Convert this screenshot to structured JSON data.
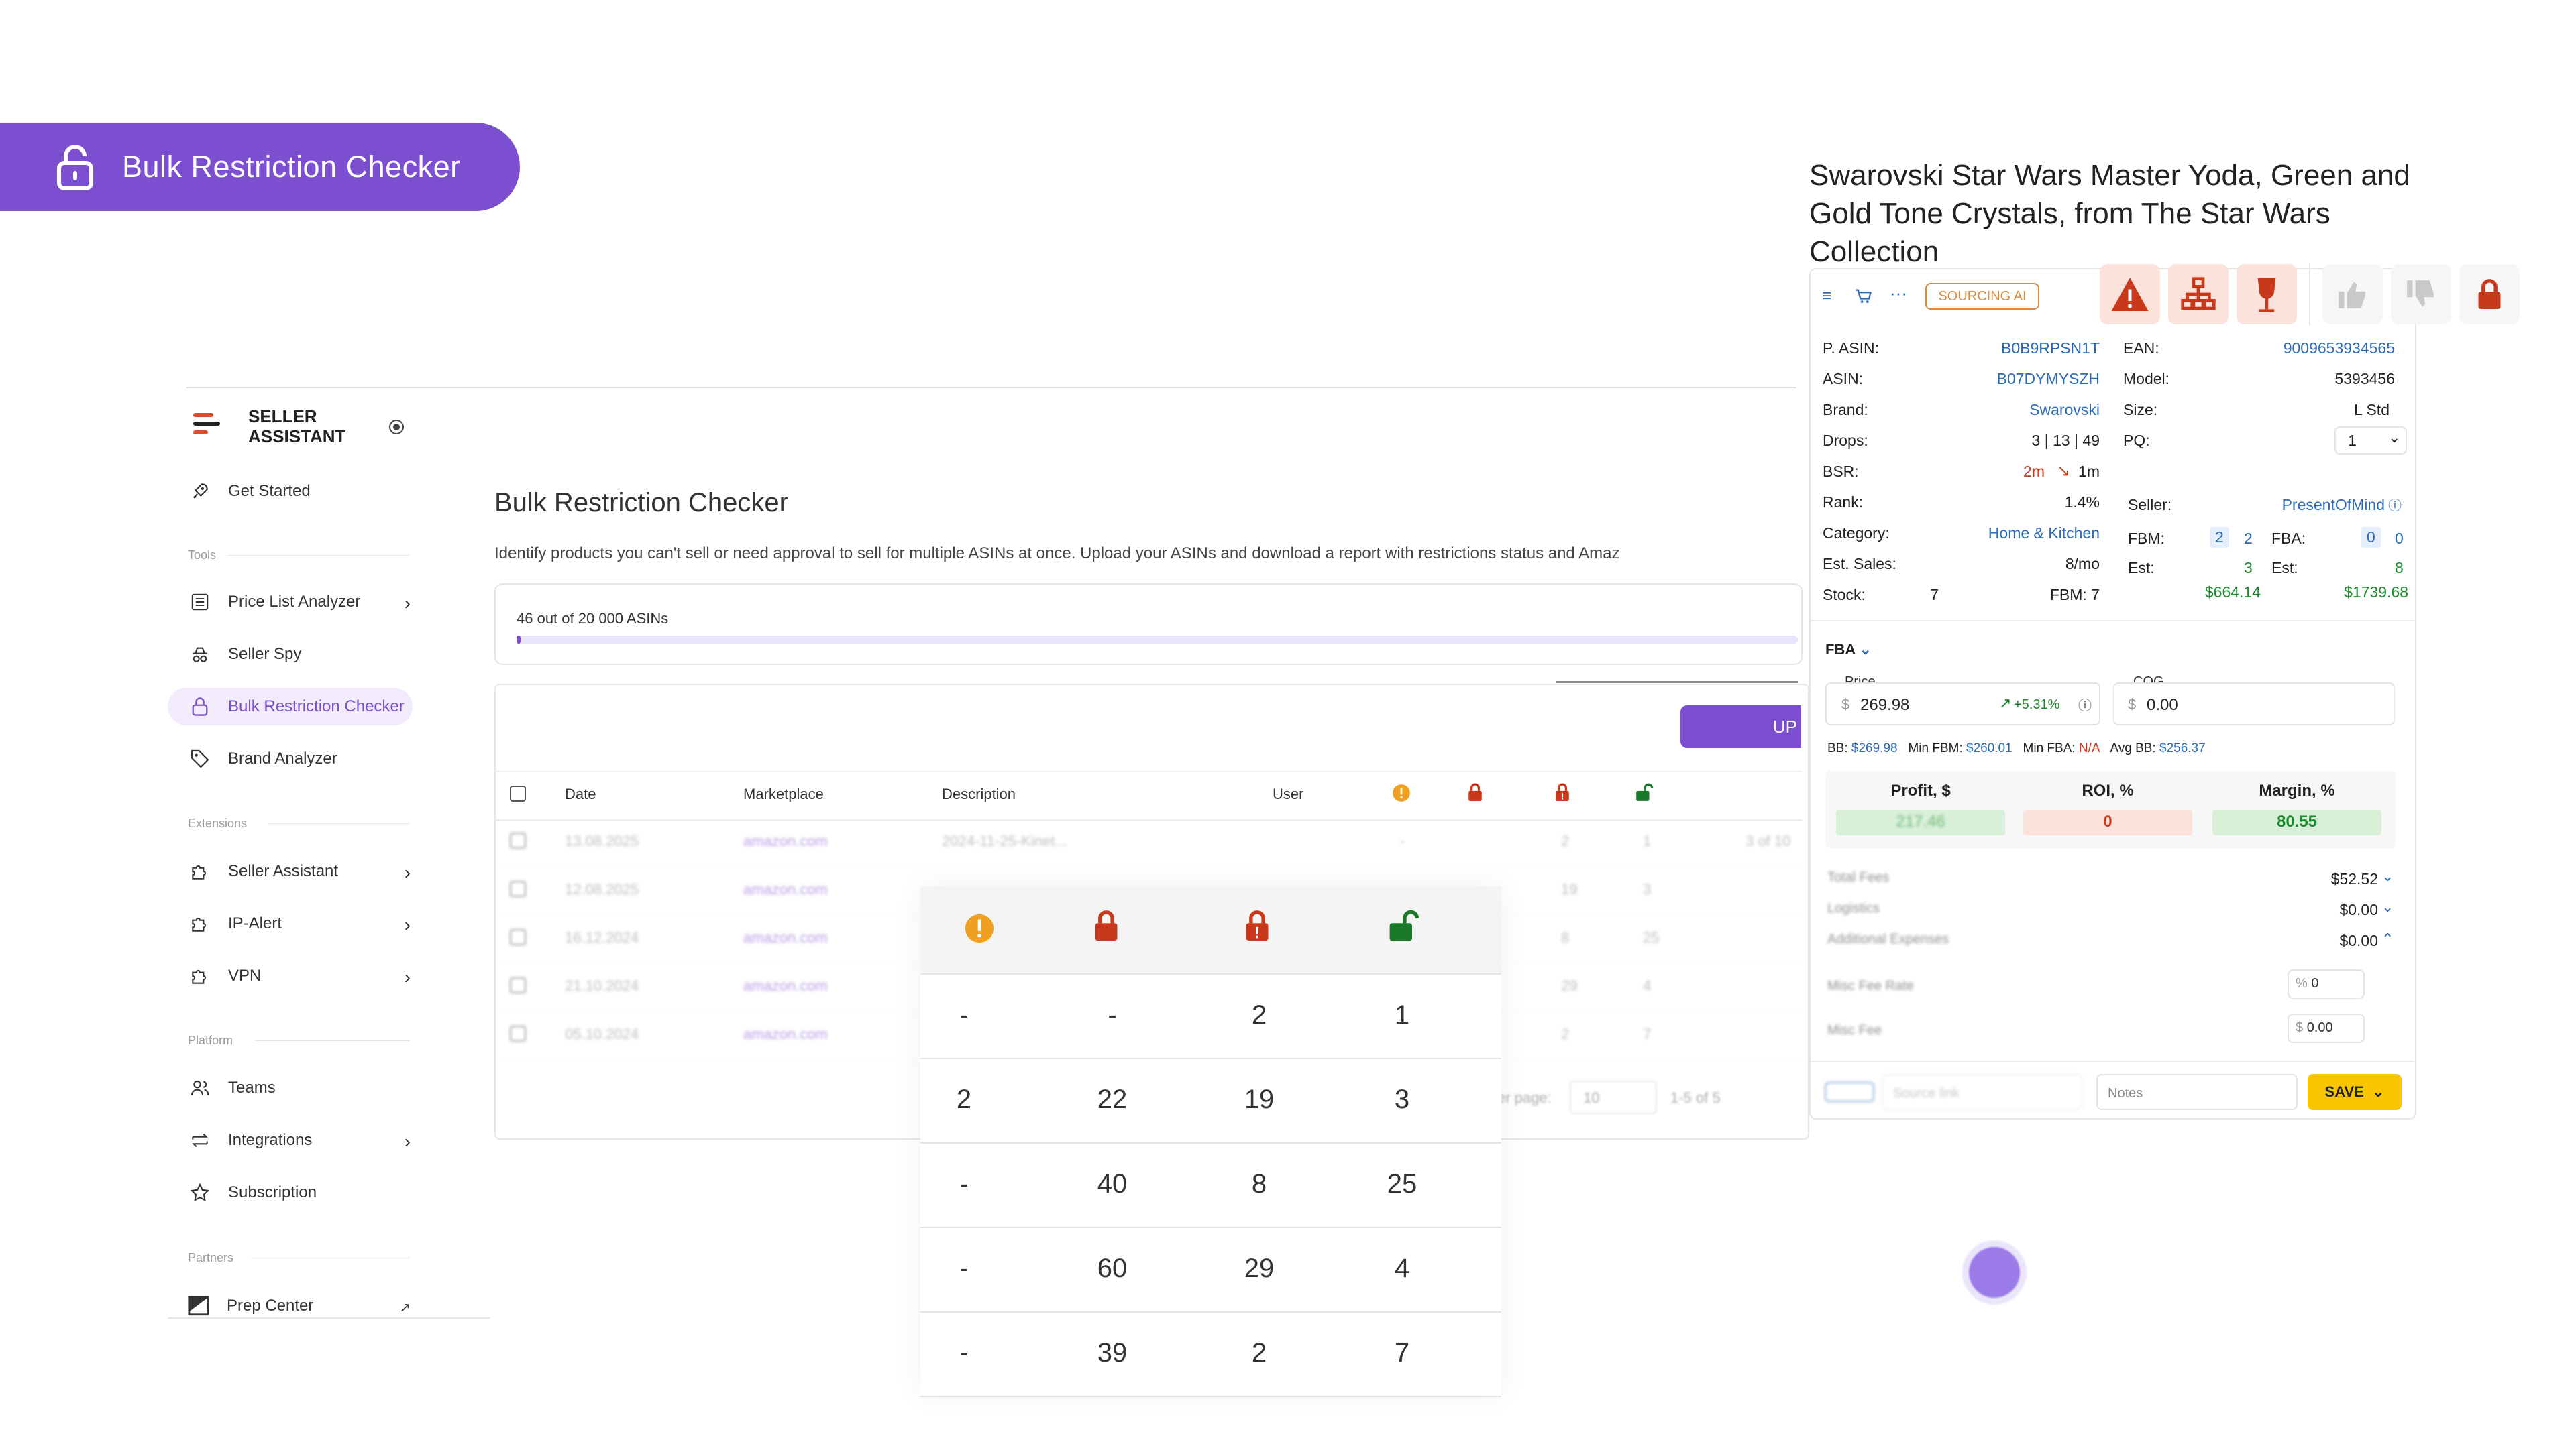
{
  "banner": {
    "title": "Bulk Restriction Checker"
  },
  "sidebar": {
    "brand_line1": "SELLER",
    "brand_line2": "ASSISTANT",
    "get_started": "Get Started",
    "sections": {
      "tools": "Tools",
      "extensions": "Extensions",
      "platform": "Platform",
      "partners": "Partners"
    },
    "tools": [
      {
        "label": "Price List Analyzer",
        "icon": "list-icon"
      },
      {
        "label": "Seller Spy",
        "icon": "spy-icon"
      },
      {
        "label": "Bulk Restriction Checker",
        "icon": "lock-icon"
      },
      {
        "label": "Brand Analyzer",
        "icon": "tag-search-icon"
      }
    ],
    "extensions": [
      {
        "label": "Seller Assistant",
        "icon": "puzzle-icon"
      },
      {
        "label": "IP-Alert",
        "icon": "puzzle-icon"
      },
      {
        "label": "VPN",
        "icon": "puzzle-icon"
      }
    ],
    "platform": [
      {
        "label": "Teams",
        "icon": "users-icon"
      },
      {
        "label": "Integrations",
        "icon": "arrows-icon"
      },
      {
        "label": "Subscription",
        "icon": "star-icon"
      }
    ],
    "partners": [
      {
        "label": "Prep Center",
        "icon": "prep-icon"
      }
    ]
  },
  "main": {
    "title": "Bulk Restriction Checker",
    "description": "Identify products you can't sell or need approval to sell for multiple ASINs at once. Upload your ASINs and download a report with restrictions status and Amaz",
    "progress_text": "46 out of 20 000 ASINs",
    "progress_fraction": 0.0023,
    "upload_label": "UP",
    "columns": [
      "Date",
      "Marketplace",
      "Description",
      "User"
    ],
    "rows": [
      {
        "date": "13.08.2025",
        "marketplace": "amazon.com",
        "description": "2024-11-25-Kinet...",
        "user": "-",
        "c1": "-",
        "c2": "2",
        "c3": "1"
      },
      {
        "date": "12.08.2025",
        "marketplace": "amazon.com",
        "description": "",
        "user": "",
        "c1": "",
        "c2": "19",
        "c3": "3"
      },
      {
        "date": "16.12.2024",
        "marketplace": "amazon.com",
        "description": "",
        "user": "",
        "c1": "",
        "c2": "8",
        "c3": "25"
      },
      {
        "date": "21.10.2024",
        "marketplace": "amazon.com",
        "description": "",
        "user": "",
        "c1": "",
        "c2": "29",
        "c3": "4"
      },
      {
        "date": "05.10.2024",
        "marketplace": "amazon.com",
        "description": "",
        "user": "",
        "c1": "",
        "c2": "2",
        "c3": "7"
      }
    ],
    "pager": {
      "rows_label": "er page:",
      "rows_value": "10",
      "range": "1-5 of 5",
      "side": "3 of 10"
    }
  },
  "zoom_table": {
    "icons": [
      "warning-icon",
      "lock-red-icon",
      "lock-alert-icon",
      "unlock-green-icon"
    ],
    "rows": [
      [
        "-",
        "-",
        "2",
        "1"
      ],
      [
        "2",
        "22",
        "19",
        "3"
      ],
      [
        "-",
        "40",
        "8",
        "25"
      ],
      [
        "-",
        "60",
        "29",
        "4"
      ],
      [
        "-",
        "39",
        "2",
        "7"
      ]
    ]
  },
  "product": {
    "title": "Swarovski Star Wars Master Yoda, Green and Gold Tone Crystals, from The Star Wars Collection",
    "sourcing": "SOURCING AI",
    "left": [
      {
        "label": "P. ASIN:",
        "value": "B0B9RPSN1T"
      },
      {
        "label": "ASIN:",
        "value": "B07DYMYSZH"
      },
      {
        "label": "Brand:",
        "value": "Swarovski"
      },
      {
        "label": "Drops:",
        "value": "3 | 13 | 49"
      },
      {
        "label": "BSR:",
        "value_a": "2m",
        "value_b": "1m"
      },
      {
        "label": "Rank:",
        "value": "1.4%"
      },
      {
        "label": "Category:",
        "value": "Home & Kitchen"
      },
      {
        "label": "Est. Sales:",
        "value": "8/mo"
      },
      {
        "label": "Stock:",
        "value": "7",
        "extra": "FBM: 7"
      }
    ],
    "right": {
      "ean_label": "EAN:",
      "ean": "9009653934565",
      "model_label": "Model:",
      "model": "5393456",
      "size_label": "Size:",
      "size": "L Std",
      "pq_label": "PQ:",
      "pq": "1",
      "seller_label": "Seller:",
      "seller": "PresentOfMind",
      "fbm_label": "FBM:",
      "fbm_a": "2",
      "fbm_b": "2",
      "fba_label": "FBA:",
      "fba_a": "0",
      "fba_b": "0",
      "est_label": "Est:",
      "est_fbm": "3",
      "est_fba": "8",
      "fbm_price": "$664.14",
      "fba_price": "$1739.68"
    },
    "fulfillment": "FBA",
    "price_label": "Price",
    "price_currency": "$",
    "price": "269.98",
    "price_change": "+5.31%",
    "cog_label": "COG",
    "cog_currency": "$",
    "cog": "0.00",
    "bb_line": {
      "bb_label": "BB:",
      "bb": "$269.98",
      "min_fbm_label": "Min FBM:",
      "min_fbm": "$260.01",
      "min_fba_label": "Min FBA:",
      "min_fba": "N/A",
      "avg_bb_label": "Avg BB:",
      "avg_bb": "$256.37"
    },
    "metrics": [
      {
        "label": "Profit, $",
        "value": "217.46"
      },
      {
        "label": "ROI, %",
        "value": "0"
      },
      {
        "label": "Margin, %",
        "value": "80.55"
      }
    ],
    "fees": [
      {
        "label": "Total Fees",
        "value": "$52.52"
      },
      {
        "label": "Logistics",
        "value": "$0.00"
      },
      {
        "label": "Additional Expenses",
        "value": "$0.00"
      }
    ],
    "misc_fee_rate_label": "Misc Fee Rate",
    "misc_fee_rate": "0",
    "misc_fee_label": "Misc Fee",
    "misc_fee": "0.00",
    "source_link_placeholder": "Source link",
    "notes_placeholder": "Notes",
    "save_label": "SAVE"
  },
  "colors": {
    "accent": "#7b4fd0",
    "danger": "#c8391b",
    "success": "#1a8a2a",
    "link": "#2a6ab7",
    "save": "#f7c600"
  }
}
